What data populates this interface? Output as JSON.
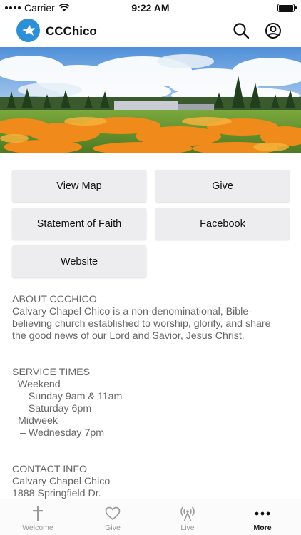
{
  "status_bar": {
    "carrier": "Carrier",
    "time": "9:22 AM"
  },
  "header": {
    "title": "CCChico"
  },
  "buttons": [
    {
      "label": "View Map"
    },
    {
      "label": "Give"
    },
    {
      "label": "Statement of Faith"
    },
    {
      "label": "Facebook"
    },
    {
      "label": "Website"
    }
  ],
  "about": {
    "heading": "ABOUT CCCHICO",
    "lines": [
      "Calvary Chapel Chico is a non-denominational, Bible-",
      "believing church established to worship, glorify, and share",
      "the good news of our Lord and Savior, Jesus Christ."
    ]
  },
  "service_times": {
    "heading": "SERVICE TIMES",
    "lines": [
      "Weekend",
      "– Sunday 9am & 11am",
      "– Saturday 6pm",
      "Midweek",
      "– Wednesday 7pm"
    ]
  },
  "contact": {
    "heading": "CONTACT INFO",
    "lines": [
      "Calvary Chapel Chico",
      "1888 Springfield Dr."
    ]
  },
  "tabs": [
    {
      "label": "Welcome",
      "icon": "cross-icon"
    },
    {
      "label": "Give",
      "icon": "heart-icon"
    },
    {
      "label": "Live",
      "icon": "broadcast-icon"
    },
    {
      "label": "More",
      "icon": "more-icon"
    }
  ],
  "colors": {
    "logo_blue": "#2d8fd5",
    "button_bg": "#ededf0",
    "text_gray": "#666666",
    "tab_inactive": "#9a9a9a"
  }
}
